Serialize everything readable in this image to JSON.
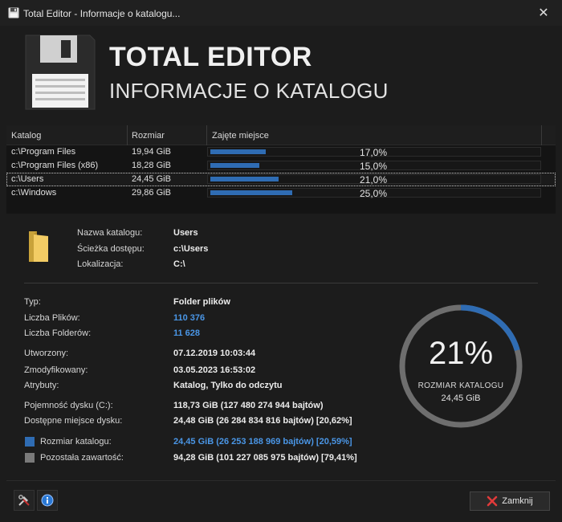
{
  "window": {
    "title": "Total Editor - Informacje o katalogu...",
    "close_glyph": "✕"
  },
  "header": {
    "app_name": "TOTAL EDITOR",
    "subtitle": "INFORMACJE O KATALOGU",
    "icon": "floppy-disk-icon"
  },
  "table": {
    "columns": [
      "Katalog",
      "Rozmiar",
      "Zajęte miejsce"
    ],
    "rows": [
      {
        "name": "c:\\Program Files",
        "size": "19,94 GiB",
        "percent_label": "17,0%",
        "fraction": 0.17,
        "selected": false
      },
      {
        "name": "c:\\Program Files (x86)",
        "size": "18,28 GiB",
        "percent_label": "15,0%",
        "fraction": 0.15,
        "selected": false
      },
      {
        "name": "c:\\Users",
        "size": "24,45 GiB",
        "percent_label": "21,0%",
        "fraction": 0.21,
        "selected": true
      },
      {
        "name": "c:\\Windows",
        "size": "29,86 GiB",
        "percent_label": "25,0%",
        "fraction": 0.25,
        "selected": false
      }
    ],
    "bar_color": "#2f6cb3"
  },
  "details": {
    "name_label": "Nazwa katalogu:",
    "name_value": "Users",
    "path_label": "Ścieżka dostępu:",
    "path_value": "c:\\Users",
    "location_label": "Lokalizacja:",
    "location_value": "C:\\",
    "type_label": "Typ:",
    "type_value": "Folder plików",
    "files_label": "Liczba Plików:",
    "files_value": "110 376",
    "folders_label": "Liczba Folderów:",
    "folders_value": "11 628",
    "created_label": "Utworzony:",
    "created_value": "07.12.2019 10:03:44",
    "modified_label": "Zmodyfikowany:",
    "modified_value": "03.05.2023 16:53:02",
    "attributes_label": "Atrybuty:",
    "attributes_value": "Katalog, Tylko do odczytu",
    "capacity_label": "Pojemność dysku (C:):",
    "capacity_value": "118,73 GiB (127 480 274 944 bajtów)",
    "free_label": "Dostępne miejsce dysku:",
    "free_value": "24,48 GiB (26 284 834 816 bajtów) [20,62%]",
    "dir_size_label": "Rozmiar katalogu:",
    "dir_size_value": "24,45 GiB (26 253 188 969 bajtów) [20,59%]",
    "remaining_label": "Pozostała zawartość:",
    "remaining_value": "94,28 GiB (101 227 085 975 bajtów) [79,41%]",
    "dir_size_color": "#2f6cb3",
    "remaining_color": "#7a7a7a",
    "accent_text_color": "#4a96e6"
  },
  "ring": {
    "percent_label": "21%",
    "fraction": 0.2059,
    "caption": "ROZMIAR KATALOGU",
    "size": "24,45 GiB",
    "fill_color": "#2f6cb3",
    "track_color": "#6e6e6e"
  },
  "footer": {
    "tools_icon": "tools-icon",
    "info_icon": "info-icon",
    "close_label": "Zamknij",
    "close_icon": "red-x-icon"
  }
}
